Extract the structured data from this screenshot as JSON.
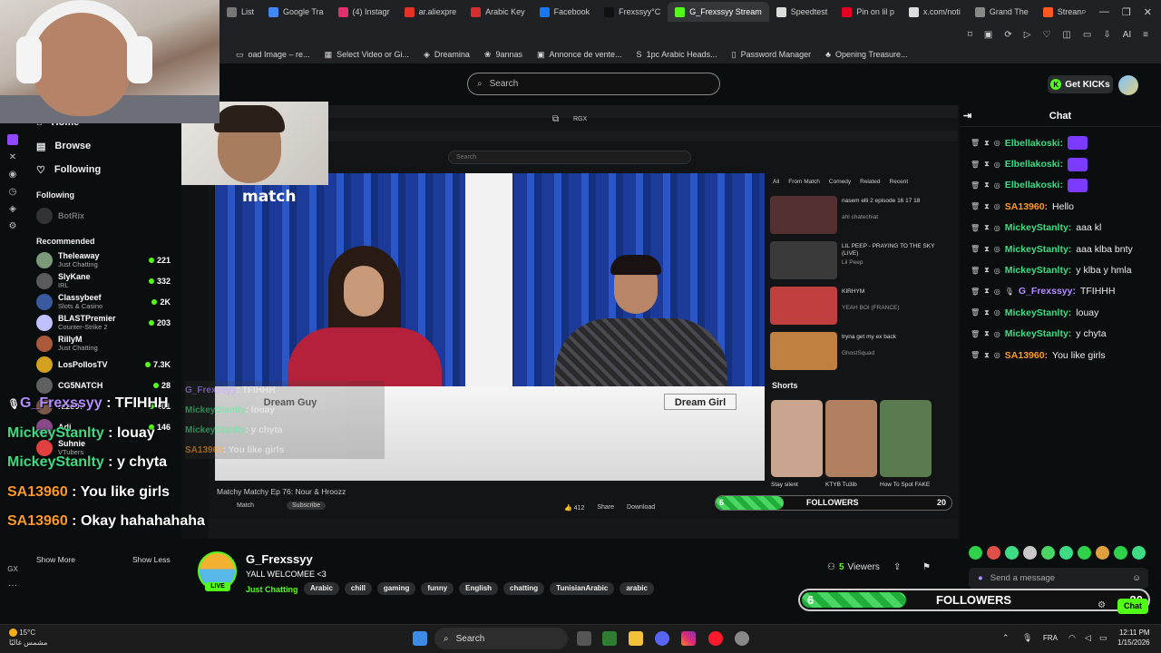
{
  "browser": {
    "tabs": [
      {
        "label": "List",
        "color": "#777"
      },
      {
        "label": "Google Tra",
        "color": "#4285f4"
      },
      {
        "label": "(4) Instagr",
        "color": "#e1306c"
      },
      {
        "label": "ar.aliexpre",
        "color": "#e43225"
      },
      {
        "label": "Arabic Key",
        "color": "#d32f2f"
      },
      {
        "label": "Facebook",
        "color": "#1877f2"
      },
      {
        "label": "Frexssyy°C",
        "color": "#111"
      },
      {
        "label": "G_Frexssyy Stream",
        "color": "#53fc18",
        "active": true
      },
      {
        "label": "Speedtest",
        "color": "#ddd"
      },
      {
        "label": "Pin on lil p",
        "color": "#e60023"
      },
      {
        "label": "x.com/noti",
        "color": "#ddd"
      },
      {
        "label": "Grand The",
        "color": "#888"
      },
      {
        "label": "Stream and",
        "color": "#ff5722"
      }
    ],
    "new_tab": "+",
    "bookmarks": [
      {
        "label": "oad Image – re...",
        "icon": "▭"
      },
      {
        "label": "Select Video or Gi...",
        "icon": "▦"
      },
      {
        "label": "Dreamina",
        "icon": "◈"
      },
      {
        "label": "9annas",
        "icon": "❀"
      },
      {
        "label": "Annonce de vente...",
        "icon": "▣"
      },
      {
        "label": "1pc Arabic Heads...",
        "icon": "S"
      },
      {
        "label": "Password Manager",
        "icon": "▯"
      },
      {
        "label": "Opening Treasure...",
        "icon": "♣"
      }
    ],
    "toolbar_ai": "AI"
  },
  "kick": {
    "search_placeholder": "Search",
    "get_kicks": "Get KICKs",
    "nav": [
      {
        "label": "Home",
        "icon": "⌂"
      },
      {
        "label": "Browse",
        "icon": "▤"
      },
      {
        "label": "Following",
        "icon": "♡"
      }
    ],
    "following_heading": "Following",
    "following": [
      {
        "name": "BotRix"
      }
    ],
    "recommended_heading": "Recommended",
    "recommended": [
      {
        "name": "Theleaway",
        "category": "Just Chatting",
        "viewers": "221",
        "color": "#7a9a7a"
      },
      {
        "name": "SlyKane",
        "category": "IRL",
        "viewers": "332",
        "color": "#5a5a5a"
      },
      {
        "name": "Classybeef",
        "category": "Slots & Casino",
        "viewers": "2K",
        "color": "#3a5aa0"
      },
      {
        "name": "BLASTPremier",
        "category": "Counter-Strike 2",
        "viewers": "203",
        "color": "#c0c0ff"
      },
      {
        "name": "RillyM",
        "category": "Just Chatting",
        "viewers": "",
        "color": "#aa5a3a"
      },
      {
        "name": "LosPollosTV",
        "category": "",
        "viewers": "7.3K",
        "color": "#d4a020"
      },
      {
        "name": "CG5NATCH",
        "category": "",
        "viewers": "28",
        "color": "#606060"
      },
      {
        "name": "razo97",
        "category": "",
        "viewers": "401",
        "color": "#7a5a4a"
      },
      {
        "name": "Adi",
        "category": "",
        "viewers": "146",
        "color": "#8a4a8a"
      },
      {
        "name": "Suhnie",
        "category": "VTubers",
        "viewers": "",
        "color": "#e04040"
      }
    ],
    "show_more": "Show More",
    "show_less": "Show Less",
    "gx_label": "GX"
  },
  "video": {
    "inner_search": "Search",
    "rgx": "RGX",
    "logo": "match",
    "dream_guy": "Dream Guy",
    "dream_girl": "Dream Girl",
    "title": "Matchy Matchy  Ep 76: Nour & Hroozz",
    "channel": "Match",
    "subscribe": "Subscribe",
    "likes": "412",
    "share": "Share",
    "download": "Download",
    "chips": [
      "All",
      "From Match",
      "Comedy",
      "Related",
      "Recent"
    ],
    "shorts_label": "Shorts",
    "recs": [
      {
        "title": "nasem elli 2 episode 16 17 18",
        "meta": "ahl chatechiat"
      },
      {
        "title": "LIL PEEP - PRAYING TO THE SKY (LIVE)",
        "meta": "Lil Peep"
      },
      {
        "title": "KIRHYM",
        "meta": "YEAH BOI (FRANCE)"
      },
      {
        "title": "tryna get my ex back",
        "meta": "GhostSquad"
      }
    ],
    "shorts": [
      {
        "title": "Stay silent"
      },
      {
        "title": "KTYB Tu3ib"
      },
      {
        "title": "How To Spot FAKE"
      }
    ],
    "overlay_chat": [
      {
        "user": "G_Frexssyy",
        "text": ": TFIHHH",
        "color": "#b58cff"
      },
      {
        "user": "MickeyStanlty",
        "text": ": louay",
        "color": "#3ddc84"
      },
      {
        "user": "MickeyStanlty",
        "text": ": y chyta",
        "color": "#3ddc84"
      },
      {
        "user": "SA13960",
        "text": ": You like girls",
        "color": "#ff9a20"
      }
    ],
    "followers_label": "FOLLOWERS",
    "followers_current": "6",
    "followers_goal": "20"
  },
  "big_overlay_chat": [
    {
      "user": "G_Frexssyy",
      "text": " : TFIHHH",
      "color": "#b58cff",
      "mic": true
    },
    {
      "user": "MickeyStanlty",
      "text": " : louay",
      "color": "#3ddc84"
    },
    {
      "user": "MickeyStanlty",
      "text": " : y chyta",
      "color": "#3ddc84"
    },
    {
      "user": "SA13960",
      "text": " : You like girls",
      "color": "#ff9a20"
    },
    {
      "user": "SA13960",
      "text": " : Okay hahahahaha",
      "color": "#ff9a20"
    }
  ],
  "stream": {
    "channel_name": "G_Frexssyy",
    "title": "YALL WELCOMEE <3",
    "category": "Just Chatting",
    "live": "LIVE",
    "tags": [
      "Arabic",
      "chill",
      "gaming",
      "funny",
      "English",
      "chatting",
      "TunisianArabic",
      "arabic"
    ],
    "viewers_count": "5",
    "viewers_label": "Viewers"
  },
  "chat": {
    "title": "Chat",
    "messages": [
      {
        "user": "Elbellakoski:",
        "text": "",
        "color": "#3ddc84",
        "emote": true
      },
      {
        "user": "Elbellakoski:",
        "text": "",
        "color": "#3ddc84",
        "emote": true
      },
      {
        "user": "Elbellakoski:",
        "text": "",
        "color": "#3ddc84",
        "emote": true
      },
      {
        "user": "SA13960:",
        "text": "Hello",
        "color": "#ff9a20"
      },
      {
        "user": "MickeyStanlty:",
        "text": "aaa kl",
        "color": "#3ddc84"
      },
      {
        "user": "MickeyStanlty:",
        "text": "aaa klba bnty",
        "color": "#3ddc84"
      },
      {
        "user": "MickeyStanlty:",
        "text": "y klba y hmla",
        "color": "#3ddc84"
      },
      {
        "user": "G_Frexssyy:",
        "text": "TFIHHH",
        "color": "#b58cff",
        "mic": true
      },
      {
        "user": "MickeyStanlty:",
        "text": "louay",
        "color": "#3ddc84"
      },
      {
        "user": "MickeyStanlty:",
        "text": "y chyta",
        "color": "#3ddc84"
      },
      {
        "user": "SA13960:",
        "text": "You like girls",
        "color": "#ff9a20"
      }
    ],
    "send_placeholder": "Send a message",
    "chat_button": "Chat",
    "emote_colors": [
      "#2fd14a",
      "#e0504a",
      "#3ddc84",
      "#c8c8c8",
      "#4ad662",
      "#3ddc84",
      "#2fd14a",
      "#e0a040",
      "#2fd14a",
      "#3ddc84"
    ],
    "followers_label": "FOLLOWERS",
    "followers_current": "6",
    "followers_goal": "20",
    "followers_progress": 0.3
  },
  "os": {
    "weather_temp": "15°C",
    "weather_desc": "مشمس غالبًا",
    "search_label": "Search",
    "lang": "FRA",
    "time": "12:11 PM",
    "date": "1/15/2026"
  }
}
